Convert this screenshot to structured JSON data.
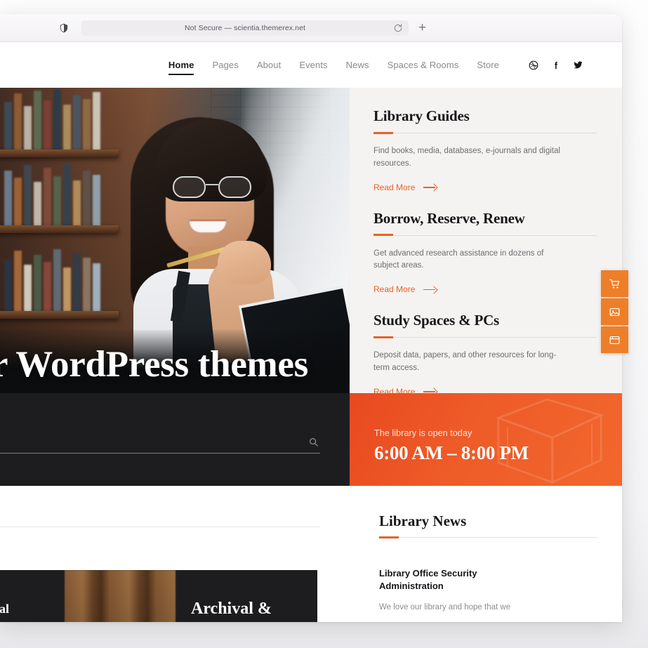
{
  "browser": {
    "url_text": "Not Secure — scientia.themerex.net",
    "shield_icon": "shield-privacy-icon",
    "reload_icon": "reload-icon",
    "newtab_label": "+"
  },
  "header": {
    "nav": [
      {
        "label": "Home",
        "active": true
      },
      {
        "label": "Pages",
        "active": false
      },
      {
        "label": "About",
        "active": false
      },
      {
        "label": "Events",
        "active": false
      },
      {
        "label": "News",
        "active": false
      },
      {
        "label": "Spaces & Rooms",
        "active": false
      },
      {
        "label": "Store",
        "active": false
      }
    ],
    "social": [
      {
        "name": "dribbble-icon",
        "glyph": "dribbble"
      },
      {
        "name": "facebook-icon",
        "glyph": "facebook"
      },
      {
        "name": "twitter-icon",
        "glyph": "twitter"
      }
    ]
  },
  "hero": {
    "title": "r WordPress themes",
    "image_alt": "woman-with-glasses-reading-in-library"
  },
  "services": [
    {
      "title": "Library Guides",
      "desc": "Find books, media, databases, e-journals and digital resources.",
      "link": "Read More"
    },
    {
      "title": "Borrow, Reserve, Renew",
      "desc": "Get advanced research assistance in dozens of subject areas.",
      "link": "Read More"
    },
    {
      "title": "Study Spaces & PCs",
      "desc": "Deposit data, papers, and other resources for long-term access.",
      "link": "Read More"
    }
  ],
  "search": {
    "value": "",
    "placeholder": "",
    "icon": "search-icon"
  },
  "hours": {
    "label": "The library is open today",
    "value": "6:00 AM – 8:00 PM",
    "watermark": "open-book-icon"
  },
  "promo": {
    "left_text": "Special",
    "right_text": "Archival &"
  },
  "news": {
    "title": "Library News",
    "items": [
      {
        "headline": "Library Office Security Administration",
        "excerpt": "We love our library and hope that we"
      }
    ]
  },
  "dock": [
    {
      "name": "cart-icon",
      "label": "Cart"
    },
    {
      "name": "gallery-icon",
      "label": "Gallery"
    },
    {
      "name": "window-icon",
      "label": "Layouts"
    }
  ],
  "colors": {
    "accent_orange": "#e8622a",
    "dock_orange": "#ee7f28",
    "hours_red": "#ee5b28",
    "dark": "#1d1d1f",
    "panel_bg": "#f4f3f1"
  }
}
